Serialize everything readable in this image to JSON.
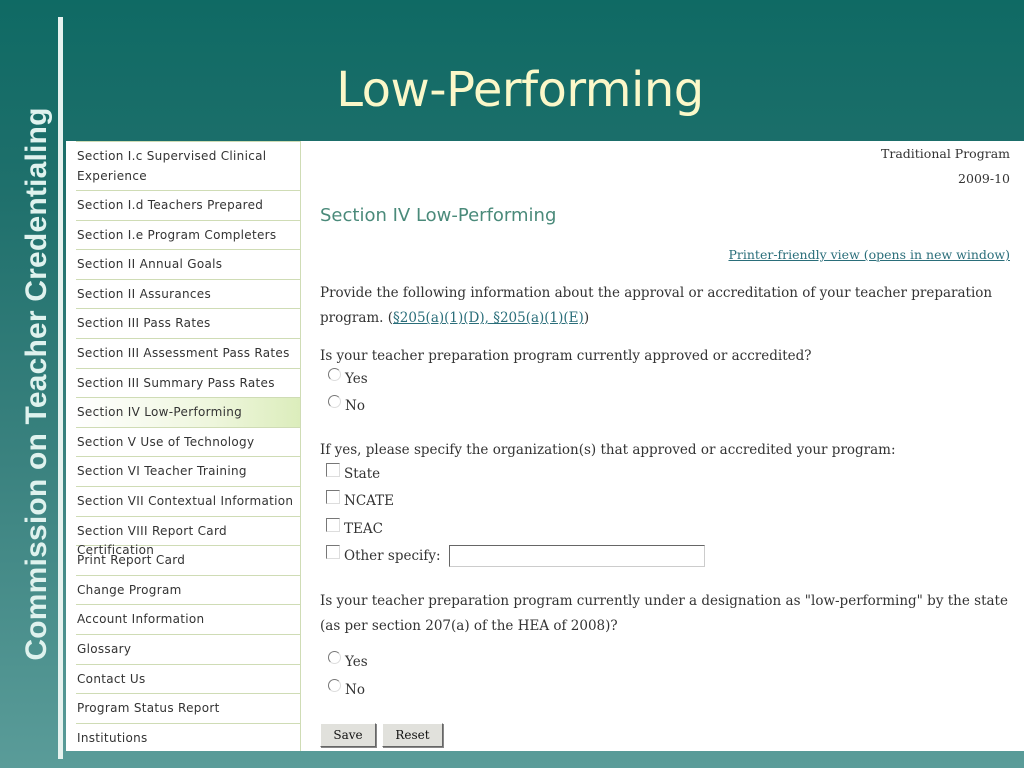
{
  "slide": {
    "vertical_title": "Commission on Teacher Credentialing",
    "title": "Low-Performing"
  },
  "sidebar": {
    "items": [
      {
        "label": "Section I.c Supervised Clinical Experience",
        "active": false
      },
      {
        "label": "Section I.d Teachers Prepared",
        "active": false
      },
      {
        "label": "Section I.e Program Completers",
        "active": false
      },
      {
        "label": "Section II Annual Goals",
        "active": false
      },
      {
        "label": "Section II Assurances",
        "active": false
      },
      {
        "label": "Section III Pass Rates",
        "active": false
      },
      {
        "label": "Section III Assessment Pass Rates",
        "active": false
      },
      {
        "label": "Section III Summary Pass Rates",
        "active": false
      },
      {
        "label": "Section IV Low-Performing",
        "active": true
      },
      {
        "label": "Section V Use of Technology",
        "active": false
      },
      {
        "label": "Section VI Teacher Training",
        "active": false
      },
      {
        "label": "Section VII Contextual Information",
        "active": false
      },
      {
        "label": "Section VIII Report Card Certification",
        "active": false
      },
      {
        "label": "Print Report Card",
        "active": false
      },
      {
        "label": "Change Program",
        "active": false
      },
      {
        "label": "Account Information",
        "active": false
      },
      {
        "label": "Glossary",
        "active": false
      },
      {
        "label": "Contact Us",
        "active": false
      },
      {
        "label": "Program Status Report",
        "active": false
      },
      {
        "label": "Institutions",
        "active": false
      }
    ]
  },
  "content": {
    "program_type": "Traditional Program",
    "program_year": "2009-10",
    "section_heading": "Section IV Low-Performing",
    "printer_link": "Printer-friendly view (opens in new window)",
    "intro_text": "Provide the following information about the approval or accreditation of your teacher preparation program. (",
    "intro_link": "§205(a)(1)(D), §205(a)(1)(E)",
    "intro_close": ")",
    "q1": {
      "text": "Is your teacher preparation program currently approved or accredited?",
      "options": [
        "Yes",
        "No"
      ],
      "selected": null
    },
    "q2": {
      "text": "If yes, please specify the organization(s) that approved or accredited your program:",
      "options": [
        {
          "label": "State",
          "checked": false
        },
        {
          "label": "NCATE",
          "checked": false
        },
        {
          "label": "TEAC",
          "checked": false
        },
        {
          "label": "Other specify:",
          "checked": false
        }
      ],
      "other_value": ""
    },
    "q3": {
      "text": "Is your teacher preparation program currently under a designation as \"low-performing\" by the state (as per section 207(a) of the HEA of 2008)?",
      "options": [
        "Yes",
        "No"
      ],
      "selected": null
    },
    "buttons": {
      "save": "Save",
      "reset": "Reset"
    }
  }
}
